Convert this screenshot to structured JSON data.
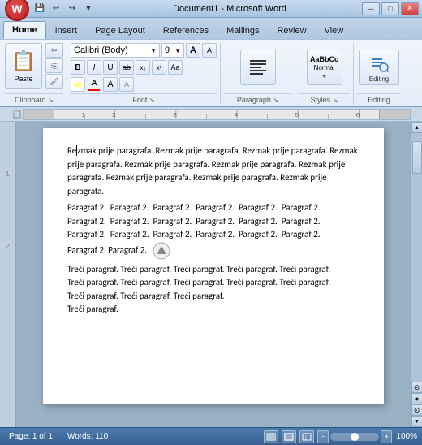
{
  "titlebar": {
    "title": "Document1 - Microsoft Word",
    "min_btn": "─",
    "restore_btn": "□",
    "close_btn": "✕"
  },
  "qat": {
    "save": "💾",
    "undo": "↩",
    "redo": "↪",
    "more": "▼"
  },
  "tabs": [
    {
      "label": "Home",
      "active": true
    },
    {
      "label": "Insert",
      "active": false
    },
    {
      "label": "Page Layout",
      "active": false
    },
    {
      "label": "References",
      "active": false
    },
    {
      "label": "Mailings",
      "active": false
    },
    {
      "label": "Review",
      "active": false
    },
    {
      "label": "View",
      "active": false
    }
  ],
  "ribbon": {
    "groups": {
      "clipboard": {
        "label": "Clipboard",
        "paste": "Paste",
        "cut": "✂",
        "copy": "⎘",
        "format_painter": "🖌"
      },
      "font": {
        "label": "Font",
        "name": "Calibri (Body)",
        "size": "9",
        "bold": "B",
        "italic": "I",
        "underline": "U",
        "strikethrough": "ab",
        "subscript": "x₂",
        "superscript": "x²",
        "clear": "A",
        "grow": "A",
        "shrink": "A",
        "color_a": "A",
        "highlight": "A"
      },
      "paragraph": {
        "label": "Paragraph"
      },
      "styles": {
        "label": "Styles"
      },
      "editing": {
        "label": "Editing"
      }
    }
  },
  "document": {
    "paragraphs": [
      "Rezmak prije paragrafa. Rezmak prije paragrafa. Rezmak prije paragrafa.",
      "Rezmak prije paragrafa. Rezmak prije paragrafa. Rezmak prije paragrafa.",
      "Rezmak prije paragrafa. Rezmak prije paragrafa. Rezmak prije paragrafa.",
      "Rezmak prije paragrafa.",
      "Paragraf 2.  Paragraf 2.  Paragraf 2.  Paragraf 2.  Paragraf 2.  Paragraf",
      "Paragraf 2.  Paragraf 2.  Paragraf 2.  Paragraf 2.  Paragraf 2.  Paragraf 2.",
      "Paragraf 2.  Paragraf 2.  Paragraf 2.  Paragraf 2.  Paragraf 2.  Paragraf 2.",
      "Paragraf 2. Paragraf 2.",
      "Treći paragraf. Treći paragraf. Treći paragraf. Treći paragraf. Treći paragraf.",
      "Treći paragraf. Treći paragraf. Treći paragraf. Treći paragraf. Treći paragraf.",
      "Treći paragraf. Treći paragraf. Treći paragraf.",
      "Treći paragraf."
    ]
  },
  "statusbar": {
    "page": "Page: 1 of 1",
    "words": "Words: 110",
    "zoom": "100%",
    "zoom_minus": "−",
    "zoom_plus": "+"
  }
}
